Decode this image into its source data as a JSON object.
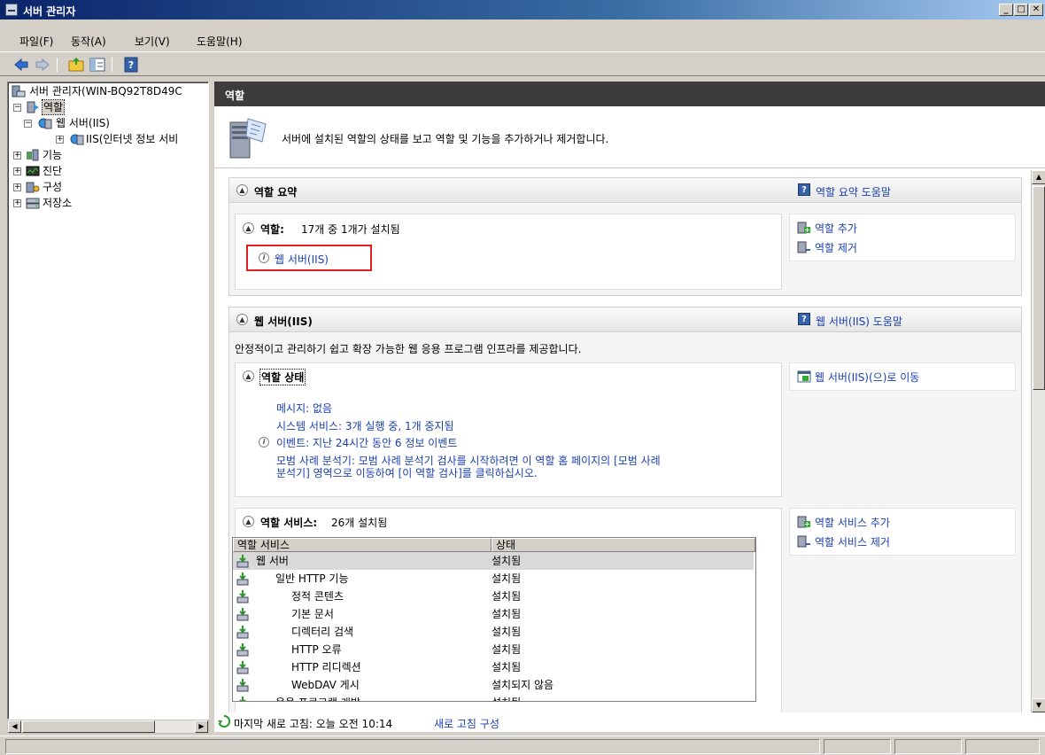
{
  "window": {
    "title": "서버 관리자"
  },
  "menu": [
    "파일(F)",
    "동작(A)",
    "보기(V)",
    "도움말(H)"
  ],
  "toolbar": {
    "buttons": [
      "back-icon",
      "forward-icon",
      "up-folder-icon",
      "show-hide-tree-icon",
      "help-icon"
    ]
  },
  "tree": {
    "root": "서버 관리자(WIN-BQ92T8D49C",
    "roles": "역할",
    "web_server": "웹 서버(IIS)",
    "iis": "IIS(인터넷 정보 서비",
    "features": "기능",
    "diagnostics": "진단",
    "configuration": "구성",
    "storage": "저장소"
  },
  "pane": {
    "header": "역할",
    "banner_text": "서버에 설치된 역할의 상태를 보고 역할 및 기능을 추가하거나 제거합니다."
  },
  "roles_summary": {
    "title": "역할 요약",
    "help_link": "역할 요약 도움말",
    "roles_label": "역할:",
    "roles_count": "17개 중 1개가 설치됨",
    "installed_role": "웹 서버(IIS)",
    "add_roles": "역할 추가",
    "remove_roles": "역할 제거"
  },
  "web_server_section": {
    "title": "웹 서버(IIS)",
    "help_link": "웹 서버(IIS) 도움말",
    "description": "안정적이고 관리하기 쉽고 확장 가능한 웹 응용 프로그램 인프라를 제공합니다.",
    "status_title": "역할 상태",
    "goto_link": "웹 서버(IIS)(으)로 이동",
    "messages": "메시지: 없음",
    "system_services": "시스템 서비스: 3개 실행 중, 1개 중지됨",
    "events": "이벤트: 지난 24시간 동안 6 정보 이벤트",
    "bpa_line1": "모범 사례 분석기: 모범 사례 분석기 검사를 시작하려면 이 역할 홈 페이지의 [모범 사례",
    "bpa_line2": "분석기] 영역으로 이동하여 [이 역할 검사]를 클릭하십시오.",
    "services_label": "역할 서비스:",
    "services_count": "26개 설치됨",
    "add_services": "역할 서비스 추가",
    "remove_services": "역할 서비스 제거"
  },
  "services_table": {
    "columns": [
      "역할 서비스",
      "상태"
    ],
    "rows": [
      {
        "name": "웹 서버",
        "status": "설치됨",
        "indent": 0
      },
      {
        "name": "일반 HTTP 기능",
        "status": "설치됨",
        "indent": 1
      },
      {
        "name": "정적 콘텐츠",
        "status": "설치됨",
        "indent": 2
      },
      {
        "name": "기본 문서",
        "status": "설치됨",
        "indent": 2
      },
      {
        "name": "디렉터리 검색",
        "status": "설치됨",
        "indent": 2
      },
      {
        "name": "HTTP 오류",
        "status": "설치됨",
        "indent": 2
      },
      {
        "name": "HTTP 리디렉션",
        "status": "설치됨",
        "indent": 2
      },
      {
        "name": "WebDAV 게시",
        "status": "설치되지 않음",
        "indent": 2
      },
      {
        "name": "응용 프로그램 개발",
        "status": "설치됨",
        "indent": 1
      }
    ]
  },
  "refresh": {
    "text": "마지막 새로 고침: 오늘 오전 10:14",
    "configure_link": "새로 고침 구성"
  }
}
